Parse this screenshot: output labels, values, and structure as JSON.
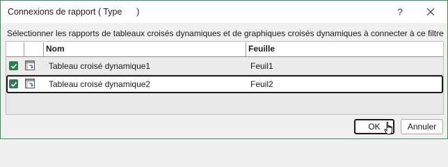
{
  "window": {
    "title": "Connexions de rapport ( Type      )",
    "help_label": "?"
  },
  "instruction": "Sélectionner les rapports de tableaux croisés dynamiques et de graphiques croisés dynamiques à connecter à ce filtre",
  "table": {
    "columns": [
      "Nom",
      "Feuille"
    ],
    "rows": [
      {
        "checked": true,
        "icon": "pivot-table-icon",
        "name": "Tableau croisé dynamique1",
        "sheet": "Feuil1"
      },
      {
        "checked": true,
        "icon": "pivot-table-icon",
        "name": "Tableau croisé dynamique2",
        "sheet": "Feuil2",
        "focused": true
      }
    ]
  },
  "buttons": {
    "ok": "OK",
    "cancel": "Annuler"
  },
  "colors": {
    "checkbox": "#2f7d4f",
    "window_border": "#3a8a5a"
  }
}
